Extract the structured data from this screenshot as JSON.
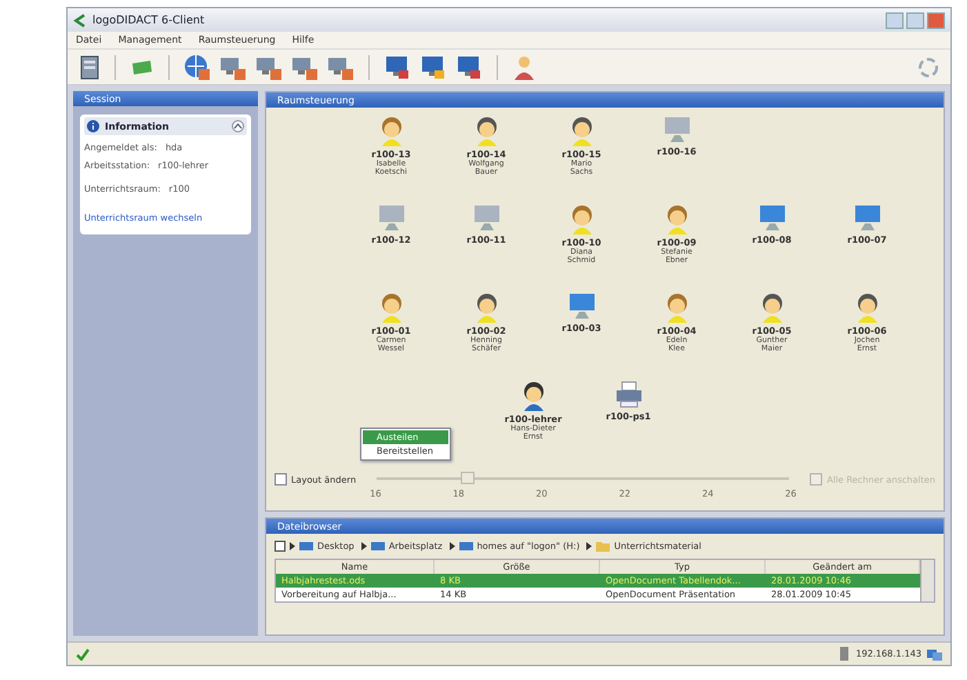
{
  "window": {
    "title": "logoDIDACT 6-Client"
  },
  "menu": [
    "Datei",
    "Management",
    "Raumsteuerung",
    "Hilfe"
  ],
  "session": {
    "title": "Session",
    "info": {
      "title": "Information",
      "expanded": true,
      "rows": [
        {
          "label": "Angemeldet als:",
          "value": "hda"
        },
        {
          "label": "Arbeitsstation:",
          "value": "r100-lehrer"
        },
        {
          "label": "Unterrichtsraum:",
          "value": "r100"
        }
      ],
      "link": "Unterrichtsraum wechseln"
    }
  },
  "room": {
    "title": "Raumsteuerung",
    "rows": [
      [
        {
          "kind": "student_female",
          "name": "r100-13",
          "user": [
            "Isabelle",
            "Koetschi"
          ]
        },
        {
          "kind": "student_male",
          "name": "r100-14",
          "user": [
            "Wolfgang",
            "Bauer"
          ]
        },
        {
          "kind": "student_male",
          "name": "r100-15",
          "user": [
            "Mario",
            "Sachs"
          ]
        },
        {
          "kind": "pc_off",
          "name": "r100-16"
        }
      ],
      [
        {
          "kind": "pc_off",
          "name": "r100-12"
        },
        {
          "kind": "pc_off",
          "name": "r100-11"
        },
        {
          "kind": "student_female",
          "name": "r100-10",
          "user": [
            "Diana",
            "Schmid"
          ]
        },
        {
          "kind": "student_female",
          "name": "r100-09",
          "user": [
            "Stefanie",
            "Ebner"
          ]
        },
        {
          "kind": "pc_on",
          "name": "r100-08"
        },
        {
          "kind": "pc_on",
          "name": "r100-07"
        }
      ],
      [
        {
          "kind": "student_female",
          "name": "r100-01",
          "user": [
            "Carmen",
            "Wessel"
          ]
        },
        {
          "kind": "student_male",
          "name": "r100-02",
          "user": [
            "Henning",
            "Schäfer"
          ]
        },
        {
          "kind": "pc_on",
          "name": "r100-03"
        },
        {
          "kind": "student_female",
          "name": "r100-04",
          "user": [
            "Edeln",
            "Klee"
          ]
        },
        {
          "kind": "student_male",
          "name": "r100-05",
          "user": [
            "Gunther",
            "Maier"
          ]
        },
        {
          "kind": "student_male",
          "name": "r100-06",
          "user": [
            "Jochen",
            "Ernst"
          ]
        }
      ]
    ],
    "extra": [
      {
        "kind": "teacher",
        "name": "r100-lehrer",
        "user": [
          "Hans-Dieter",
          "Ernst"
        ]
      },
      {
        "kind": "printer",
        "name": "r100-ps1"
      }
    ],
    "context_menu": [
      {
        "label": "Austeilen",
        "selected": true
      },
      {
        "label": "Bereitstellen",
        "selected": false
      }
    ],
    "layout_checkbox": {
      "label": "Layout ändern",
      "checked": false
    },
    "slider": {
      "level": 0.22,
      "ticks": [
        "16",
        "18",
        "20",
        "22",
        "24",
        "26"
      ],
      "disabled": true
    },
    "right_checkbox": {
      "label": "Alle Rechner anschalten",
      "checked": false,
      "disabled": true
    }
  },
  "files": {
    "title": "Dateibrowser",
    "path": [
      "Desktop",
      "Arbeitsplatz",
      "homes auf \"logon\" (H:)",
      "Unterrichtsmaterial"
    ],
    "columns": [
      "Name",
      "Größe",
      "Typ",
      "Geändert am"
    ],
    "rows": [
      {
        "cells": [
          "Halbjahrestest.ods",
          "8 KB",
          "OpenDocument Tabellendok...",
          "28.01.2009 10:46"
        ],
        "selected": true
      },
      {
        "cells": [
          "Vorbereitung auf Halbja...",
          "14 KB",
          "OpenDocument Präsentation",
          "28.01.2009 10:45"
        ],
        "selected": false
      }
    ]
  },
  "status_bar": {
    "ip": "192.168.1.143"
  }
}
